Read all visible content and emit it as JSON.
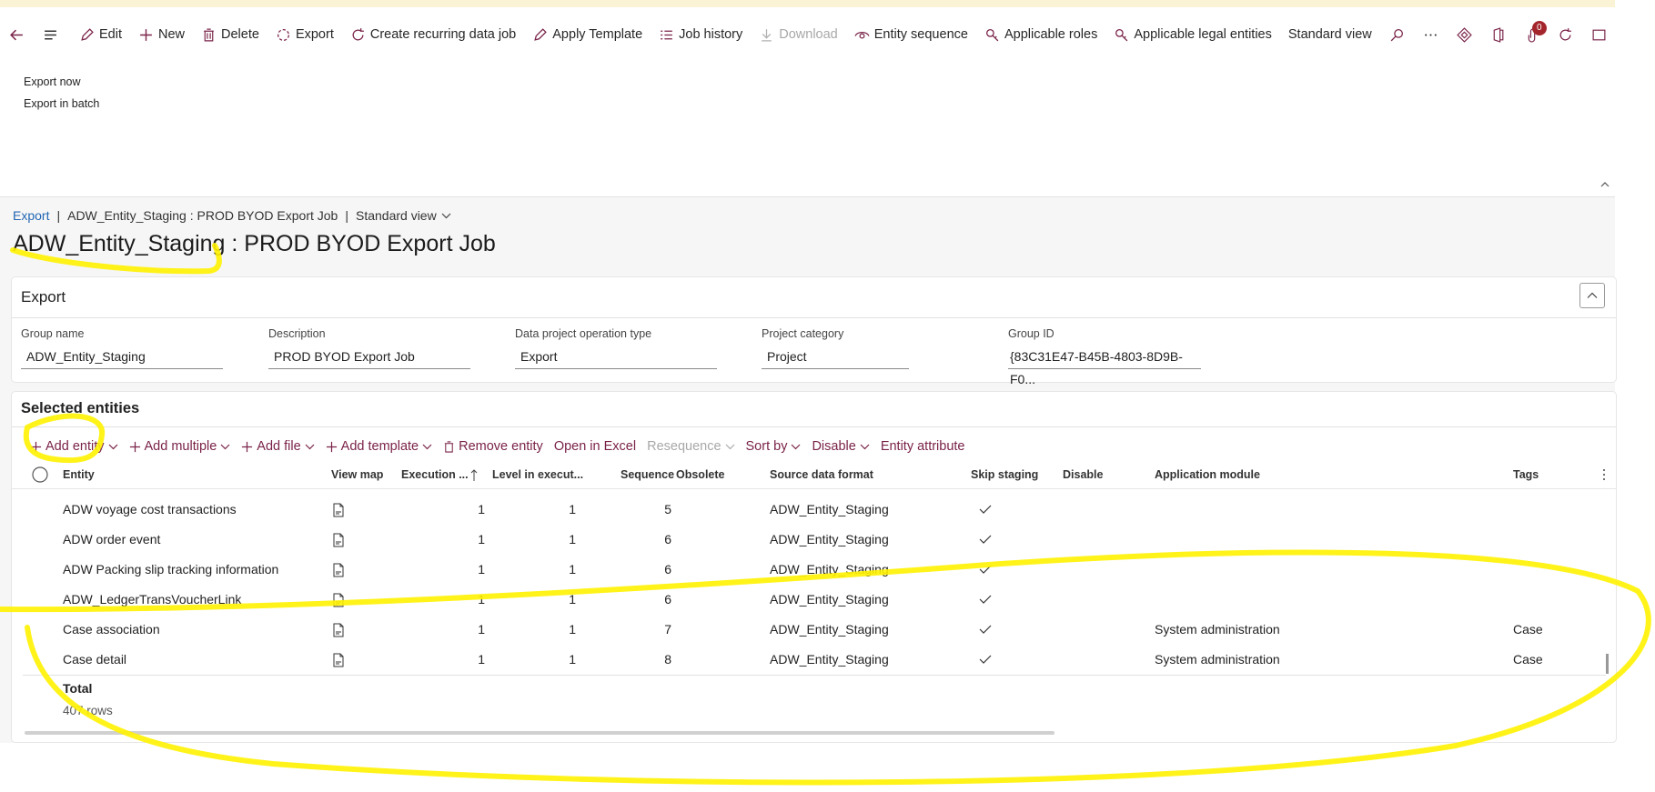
{
  "toolbar": {
    "back_label": "",
    "menu_label": "",
    "items": [
      {
        "label": "Edit",
        "icon": "pencil-icon"
      },
      {
        "label": "New",
        "icon": "plus-icon"
      },
      {
        "label": "Delete",
        "icon": "trash-icon"
      },
      {
        "label": "Export",
        "icon": "export-icon"
      },
      {
        "label": "Create recurring data job",
        "icon": "recurring-icon"
      },
      {
        "label": "Apply Template",
        "icon": "pencil-icon"
      },
      {
        "label": "Job history",
        "icon": "list-icon"
      },
      {
        "label": "Download",
        "icon": "download-icon",
        "disabled": true
      },
      {
        "label": "Entity sequence",
        "icon": "eye-icon"
      },
      {
        "label": "Applicable roles",
        "icon": "key-icon"
      },
      {
        "label": "Applicable legal entities",
        "icon": "key-icon"
      },
      {
        "label": "Standard view",
        "icon": ""
      }
    ],
    "notification_count": "0"
  },
  "export_menu": {
    "items": [
      "Export now",
      "Export in batch"
    ]
  },
  "breadcrumb": {
    "root": "Export",
    "current": "ADW_Entity_Staging : PROD BYOD Export Job",
    "view": "Standard view"
  },
  "page_title": "ADW_Entity_Staging : PROD BYOD Export Job",
  "export_section": {
    "title": "Export",
    "fields": [
      {
        "label": "Group name",
        "value": "ADW_Entity_Staging"
      },
      {
        "label": "Description",
        "value": "PROD BYOD Export Job"
      },
      {
        "label": "Data project operation type",
        "value": "Export"
      },
      {
        "label": "Project category",
        "value": "Project"
      },
      {
        "label": "Group ID",
        "value": "{83C31E47-B45B-4803-8D9B-F0..."
      }
    ]
  },
  "entities_section": {
    "title": "Selected entities",
    "actions": {
      "add_entity": "Add entity",
      "add_multiple": "Add multiple",
      "add_file": "Add file",
      "add_template": "Add template",
      "remove_entity": "Remove entity",
      "open_in_excel": "Open in Excel",
      "resequence": "Resequence",
      "sort_by": "Sort by",
      "disable": "Disable",
      "entity_attribute": "Entity attribute"
    },
    "columns": {
      "entity": "Entity",
      "view_map": "View map",
      "execution": "Execution ...",
      "level": "Level in execut...",
      "sequence": "Sequence",
      "obsolete": "Obsolete",
      "source_format": "Source data format",
      "skip_staging": "Skip staging",
      "disable": "Disable",
      "app_module": "Application module",
      "tags": "Tags"
    },
    "rows": [
      {
        "entity": "ADW voyage cost transactions",
        "execution": "1",
        "level": "1",
        "sequence": "5",
        "source": "ADW_Entity_Staging",
        "skip": true,
        "module": "",
        "tags": ""
      },
      {
        "entity": "ADW order event",
        "execution": "1",
        "level": "1",
        "sequence": "6",
        "source": "ADW_Entity_Staging",
        "skip": true,
        "module": "",
        "tags": ""
      },
      {
        "entity": "ADW Packing slip tracking information",
        "execution": "1",
        "level": "1",
        "sequence": "6",
        "source": "ADW_Entity_Staging",
        "skip": true,
        "module": "",
        "tags": ""
      },
      {
        "entity": "ADW_LedgerTransVoucherLink",
        "execution": "1",
        "level": "1",
        "sequence": "6",
        "source": "ADW_Entity_Staging",
        "skip": true,
        "module": "",
        "tags": ""
      },
      {
        "entity": "Case association",
        "execution": "1",
        "level": "1",
        "sequence": "7",
        "source": "ADW_Entity_Staging",
        "skip": true,
        "module": "System administration",
        "tags": "Case"
      },
      {
        "entity": "Case detail",
        "execution": "1",
        "level": "1",
        "sequence": "8",
        "source": "ADW_Entity_Staging",
        "skip": true,
        "module": "System administration",
        "tags": "Case"
      }
    ],
    "total_label": "Total",
    "total_rows": "407 rows"
  },
  "colors": {
    "accent": "#7a2348",
    "link": "#2266b3",
    "annotation": "#fff200"
  }
}
